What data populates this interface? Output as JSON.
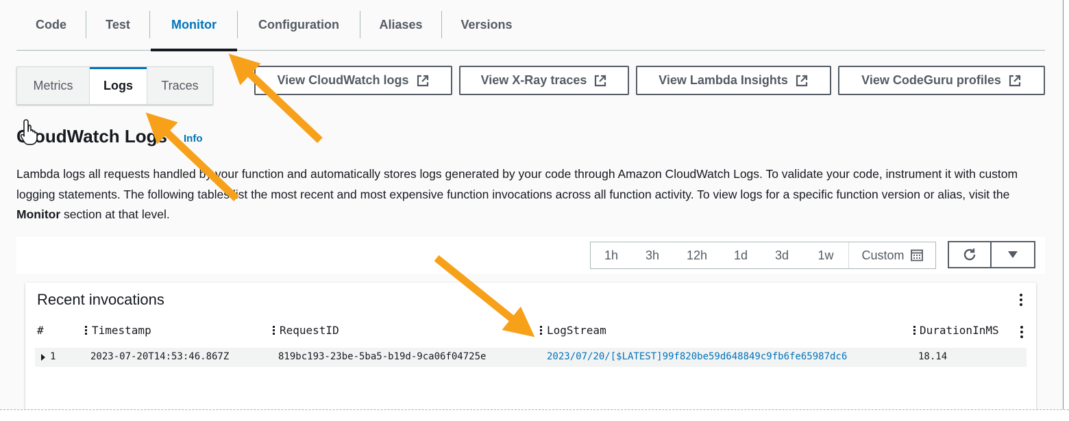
{
  "main_tabs": {
    "items": [
      {
        "label": "Code"
      },
      {
        "label": "Test"
      },
      {
        "label": "Monitor"
      },
      {
        "label": "Configuration"
      },
      {
        "label": "Aliases"
      },
      {
        "label": "Versions"
      }
    ],
    "active": "Monitor"
  },
  "sub_tabs": {
    "items": [
      {
        "label": "Metrics"
      },
      {
        "label": "Logs"
      },
      {
        "label": "Traces"
      }
    ],
    "active": "Logs"
  },
  "external_buttons": [
    {
      "label": "View CloudWatch logs",
      "icon": "external-link-icon"
    },
    {
      "label": "View X-Ray traces",
      "icon": "external-link-icon"
    },
    {
      "label": "View Lambda Insights",
      "icon": "external-link-icon"
    },
    {
      "label": "View CodeGuru profiles",
      "icon": "external-link-icon"
    }
  ],
  "section": {
    "title": "CloudWatch Logs",
    "info_label": "Info",
    "description_part1": "Lambda logs all requests handled by your function and automatically stores logs generated by your code through Amazon CloudWatch Logs. To validate your code, instrument it with custom logging statements. The following tables list the most recent and most expensive function invocations across all function activity. To view logs for a specific function version or alias, visit the ",
    "description_bold": "Monitor",
    "description_part2": " section at that level."
  },
  "time_range": {
    "options": [
      "1h",
      "3h",
      "12h",
      "1d",
      "3d",
      "1w"
    ],
    "custom_label": "Custom",
    "custom_icon": "calendar-icon",
    "refresh_icon": "refresh-icon",
    "dropdown_icon": "caret-down-icon"
  },
  "invocations": {
    "title": "Recent invocations",
    "columns": [
      "#",
      "Timestamp",
      "RequestID",
      "LogStream",
      "DurationInMS"
    ],
    "rows": [
      {
        "index": "1",
        "timestamp": "2023-07-20T14:53:46.867Z",
        "request_id": "819bc193-23be-5ba5-b19d-9ca06f04725e",
        "log_stream": "2023/07/20/[$LATEST]99f820be59d648849c9fb6fe65987dc6",
        "duration_ms": "18.14"
      }
    ]
  },
  "colors": {
    "accent_blue": "#0073bb",
    "annotation_arrow": "#f7a11a",
    "text_dark": "#16191f",
    "text_muted": "#545b64"
  }
}
